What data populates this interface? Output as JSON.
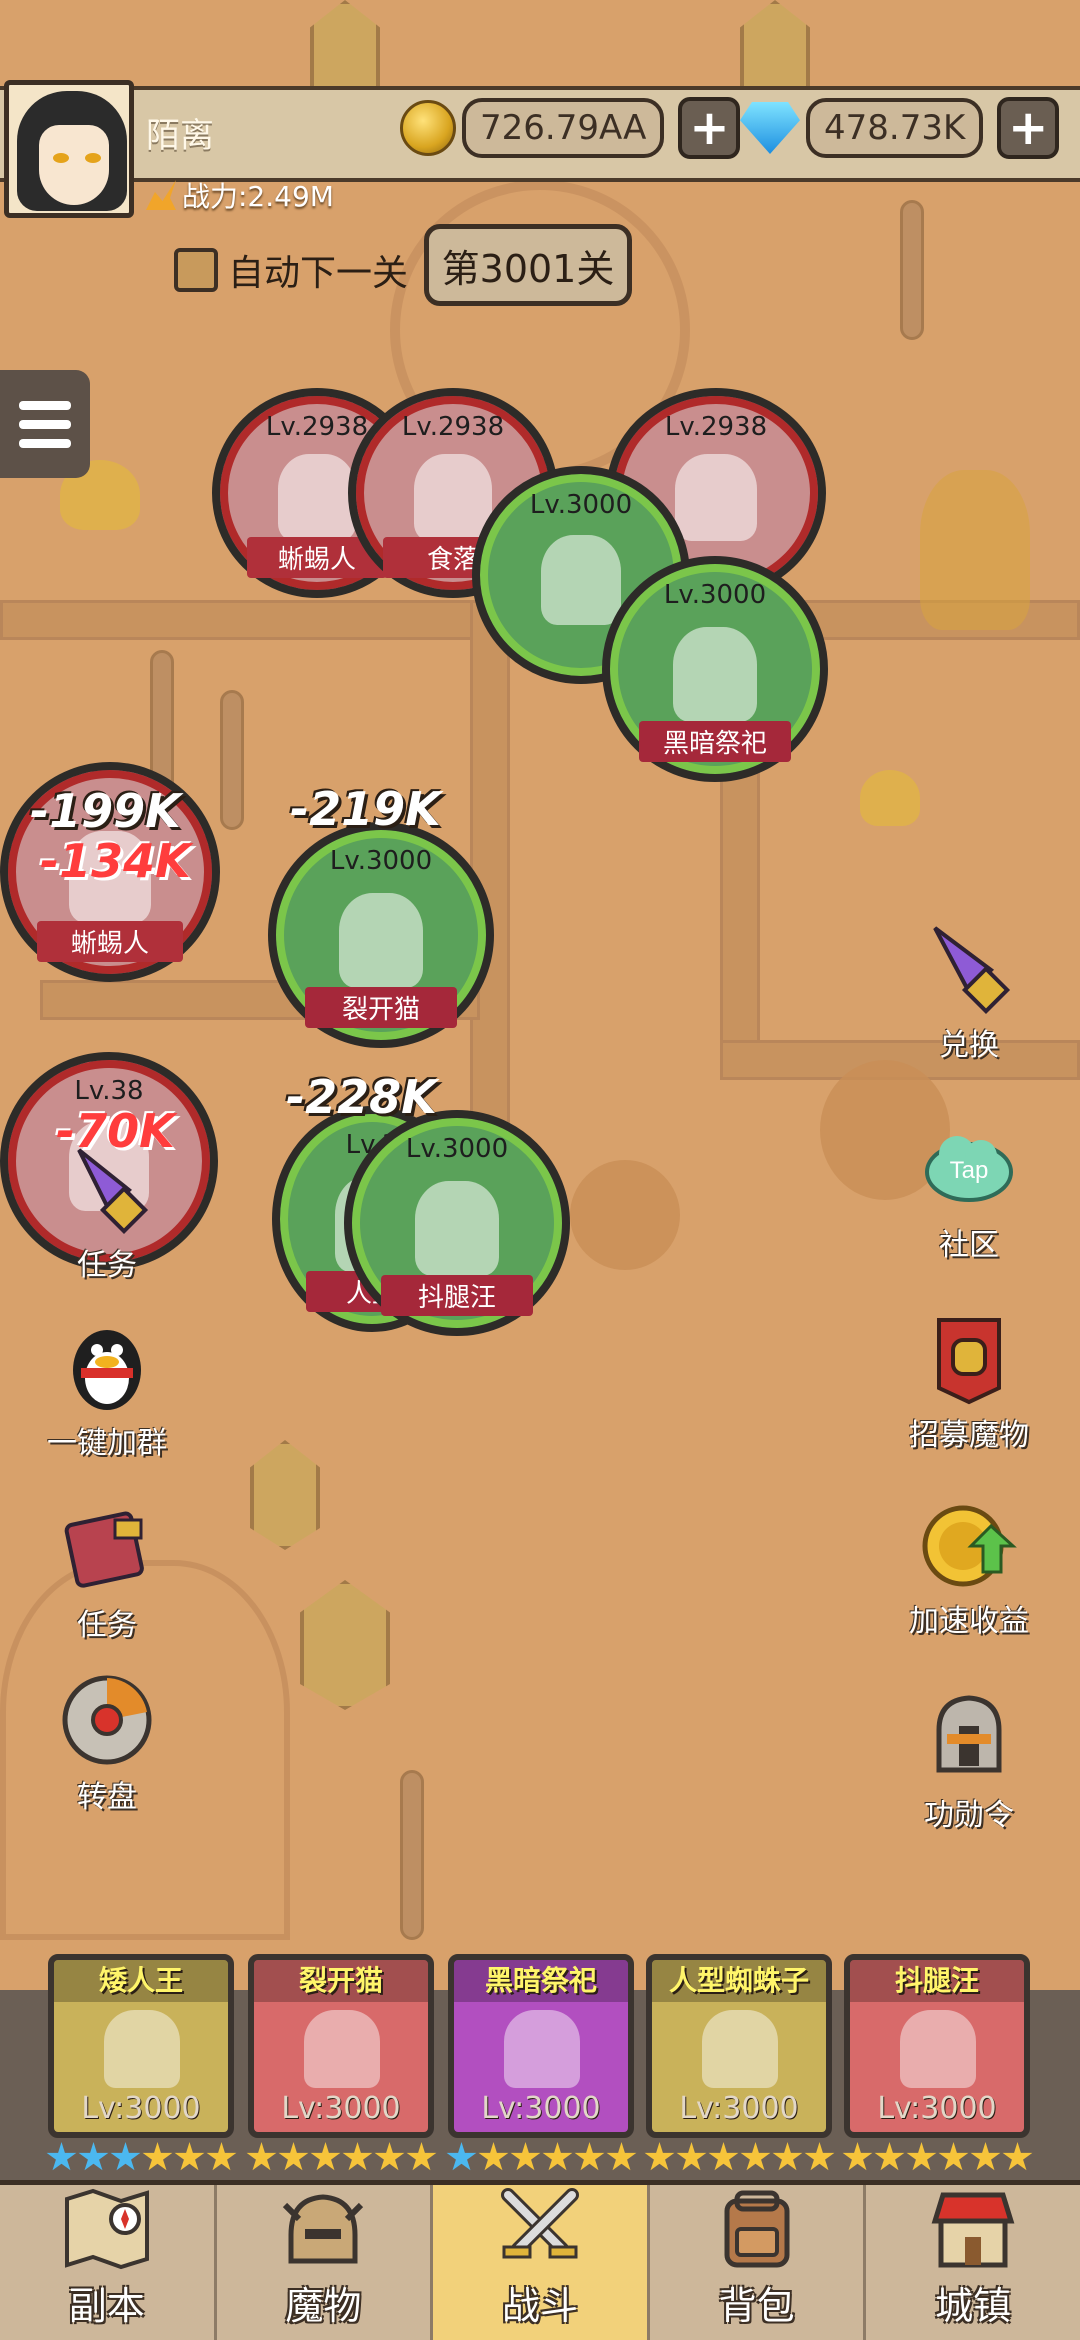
{
  "player": {
    "name": "陌离",
    "power": "战力:2.49M"
  },
  "currency": {
    "gold": "726.79AA",
    "gems": "478.73K"
  },
  "stage": {
    "auto_next_label": "自动下一关",
    "auto_next_checked": false,
    "current": "第3001关"
  },
  "units": [
    {
      "level": "Lv.2938",
      "name": "蜥蜴人",
      "side": "enemy"
    },
    {
      "level": "Lv.2938",
      "name": "食落",
      "side": "enemy"
    },
    {
      "level": "Lv.2938",
      "name": "",
      "side": "enemy"
    },
    {
      "level": "Lv.3000",
      "name": "",
      "side": "ally"
    },
    {
      "level": "Lv.3000",
      "name": "黑暗祭祀",
      "side": "ally"
    },
    {
      "level": "",
      "name": "蜥蜴人",
      "side": "enemy"
    },
    {
      "level": "Lv.3000",
      "name": "裂开猫",
      "side": "ally"
    },
    {
      "level": "Lv.38",
      "name": "",
      "side": "enemy"
    },
    {
      "level": "Lv.3",
      "name": "人型",
      "side": "ally"
    },
    {
      "level": "Lv.3000",
      "name": "抖腿汪",
      "side": "ally"
    }
  ],
  "damage_numbers": [
    "-199K",
    "-134K",
    "-219K",
    "-228K",
    "-70K"
  ],
  "side_buttons_left": [
    {
      "label": "任务",
      "icon": "rocket-icon"
    },
    {
      "label": "一键加群",
      "icon": "penguin-icon"
    },
    {
      "label": "任务",
      "icon": "book-icon"
    },
    {
      "label": "转盘",
      "icon": "wheel-icon"
    }
  ],
  "side_buttons_right": [
    {
      "label": "兑换",
      "icon": "rocket-icon"
    },
    {
      "label": "社区",
      "icon": "tap-cloud-icon"
    },
    {
      "label": "招募魔物",
      "icon": "helmet-banner-icon"
    },
    {
      "label": "加速收益",
      "icon": "coin-arrow-icon"
    },
    {
      "label": "功勋令",
      "icon": "knight-helmet-icon"
    }
  ],
  "cards": [
    {
      "name": "矮人王",
      "level": "Lv:3000",
      "color": "#c9b25a",
      "stars": [
        "blue",
        "blue",
        "blue",
        "gold",
        "gold"
      ]
    },
    {
      "name": "裂开猫",
      "level": "Lv:3000",
      "color": "#d86a6a",
      "stars": [
        "gold",
        "gold",
        "gold",
        "gold",
        "gold"
      ]
    },
    {
      "name": "黑暗祭祀",
      "level": "Lv:3000",
      "color": "#b24fc0",
      "stars": [
        "blue",
        "gold",
        "gold",
        "gold",
        "gold"
      ]
    },
    {
      "name": "人型蜘蛛子",
      "level": "Lv:3000",
      "color": "#c9b25a",
      "stars": [
        "gold",
        "gold",
        "gold",
        "gold",
        "gold"
      ]
    },
    {
      "name": "抖腿汪",
      "level": "Lv:3000",
      "color": "#d86a6a",
      "stars": [
        "gold",
        "gold",
        "gold",
        "gold",
        "gold"
      ]
    }
  ],
  "nav": [
    {
      "label": "副本",
      "icon": "map-icon",
      "active": false
    },
    {
      "label": "魔物",
      "icon": "monster-helmet-icon",
      "active": false
    },
    {
      "label": "战斗",
      "icon": "crossed-swords-icon",
      "active": true
    },
    {
      "label": "背包",
      "icon": "backpack-icon",
      "active": false
    },
    {
      "label": "城镇",
      "icon": "shop-icon",
      "active": false
    }
  ]
}
